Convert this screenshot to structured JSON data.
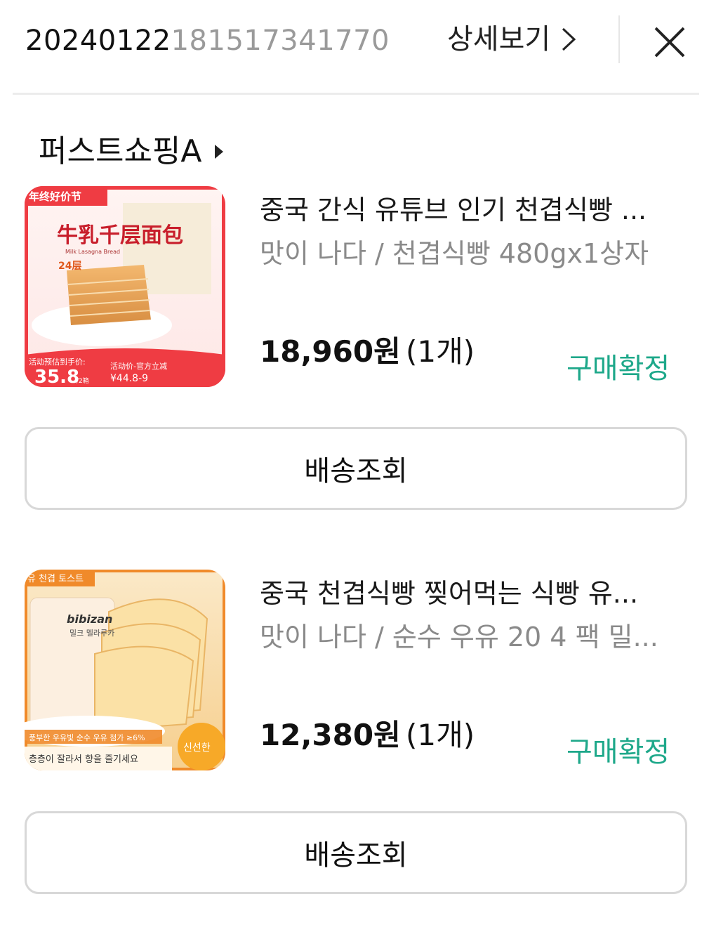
{
  "header": {
    "order_number_prefix": "20240122",
    "order_number_suffix": "181517341770",
    "detail_label": "상세보기"
  },
  "seller": {
    "name": "퍼스트쇼핑A"
  },
  "items": [
    {
      "title": "중국 간식 유튜브 인기 천겹식빵 ...",
      "option": "맛이 나다 / 천겹식빵 480gx1상자",
      "price": "18,960원",
      "qty": "(1개)",
      "status": "구매확정",
      "track_label": "배송조회",
      "thumb_text": {
        "badge": "年终好价节",
        "brand": "牛乳千层面包",
        "sub": "Milk Lasagna Bread",
        "layers": "24层",
        "promo_label": "活动预估到手价:",
        "promo_price": "35.8",
        "promo_unit": "/2箱",
        "promo_right_label": "活动价-官方立减",
        "promo_right_value": "¥44.8-9"
      }
    },
    {
      "title": "중국 천겹식빵 찢어먹는 식빵 유...",
      "option": "맛이 나다 / 순수 우유 20 4 팩 밀...",
      "price": "12,380원",
      "qty": "(1개)",
      "status": "구매확정",
      "track_label": "배송조회",
      "thumb_text": {
        "badge": "유 천겹 토스트",
        "brand": "bibizan",
        "sub": "밀크 멜라루카",
        "footer1": "풍부한 우유빛 순수 우유 첨가 ≥6%",
        "footer2": "층층이 잘라서 향을 즐기세요",
        "fresh": "신선한"
      }
    }
  ],
  "colors": {
    "accent_green": "#1ea88a",
    "border": "#d8d8d8"
  }
}
